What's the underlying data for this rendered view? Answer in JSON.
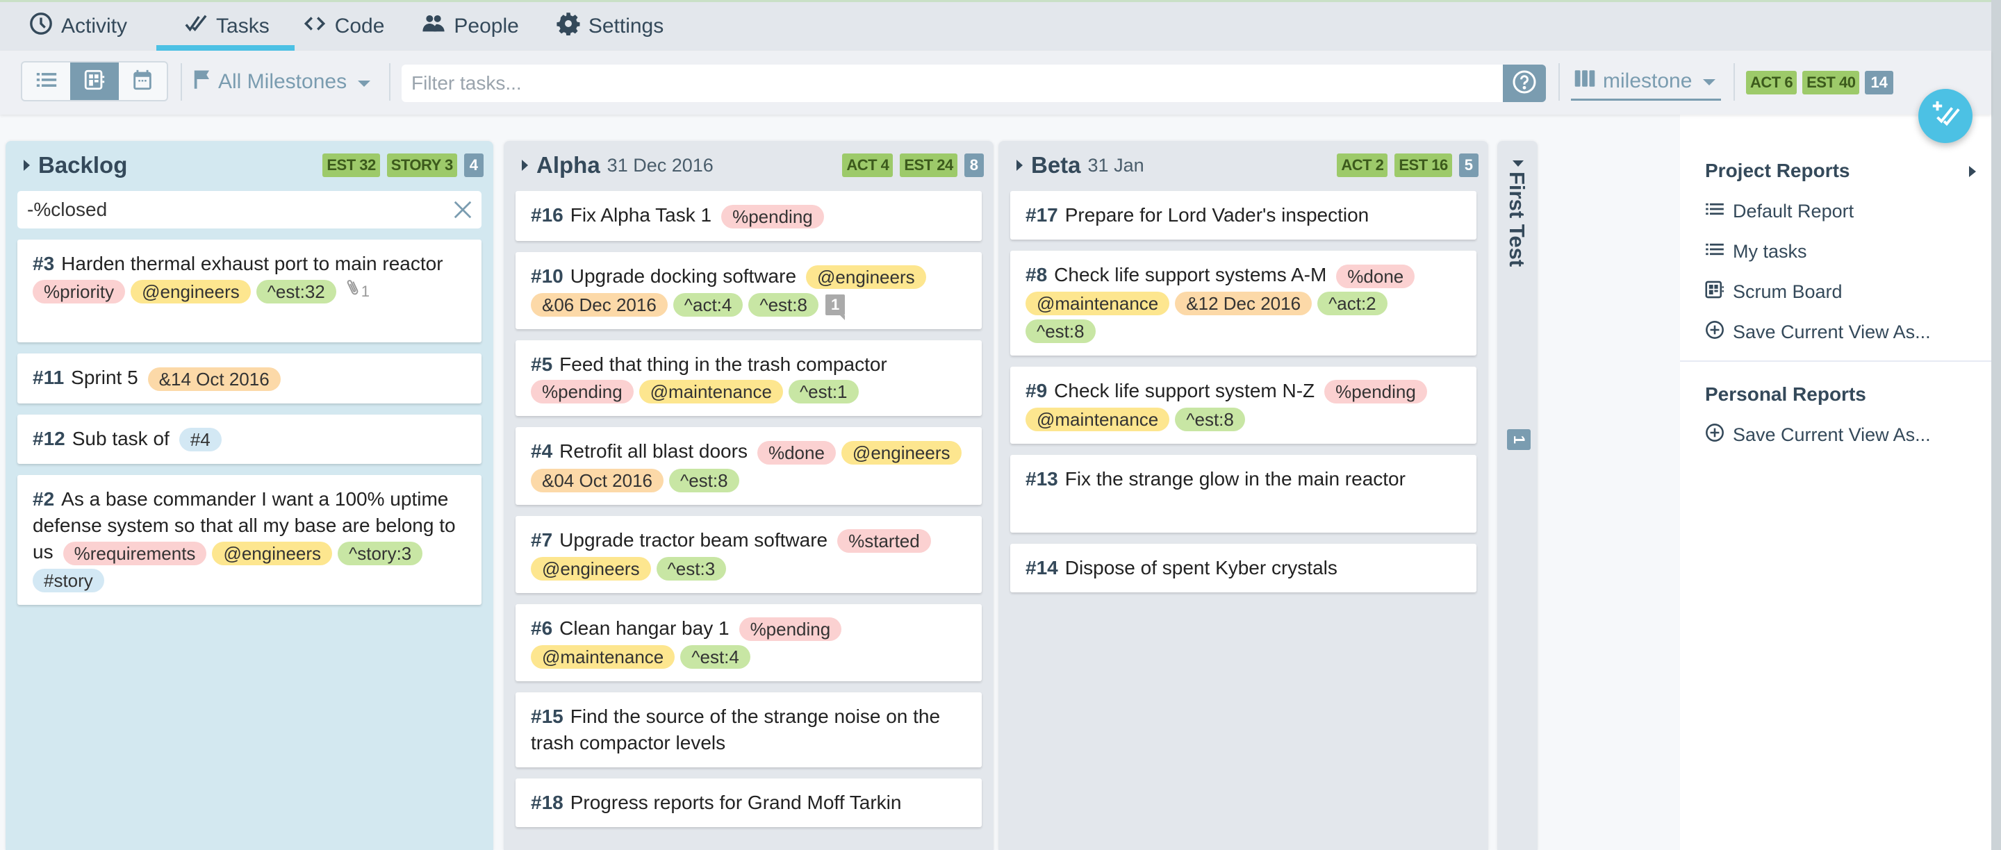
{
  "nav": {
    "tabs": [
      {
        "label": "Activity",
        "icon": "clock-icon"
      },
      {
        "label": "Tasks",
        "icon": "double-check-icon",
        "active": true
      },
      {
        "label": "Code",
        "icon": "code-icon"
      },
      {
        "label": "People",
        "icon": "people-icon"
      },
      {
        "label": "Settings",
        "icon": "gear-icon"
      }
    ]
  },
  "toolbar": {
    "view_modes": [
      "list",
      "board",
      "calendar"
    ],
    "active_view": "board",
    "milestone_filter": "All Milestones",
    "filter_placeholder": "Filter tasks...",
    "filter_value": "",
    "group_by": "milestone",
    "totals": {
      "act": "ACT 6",
      "est": "EST 40",
      "count": "14"
    }
  },
  "columns": {
    "backlog": {
      "title": "Backlog",
      "date": "",
      "badges": {
        "est": "EST 32",
        "story": "STORY 3",
        "count": "4"
      },
      "filter_value": "-%closed",
      "cards": [
        {
          "num": "#3",
          "title": "Harden thermal exhaust port to main reactor",
          "tags": [
            {
              "text": "%priority",
              "type": "status"
            },
            {
              "text": "@engineers",
              "type": "person"
            },
            {
              "text": "^est:32",
              "type": "est"
            }
          ],
          "attachments": "1"
        },
        {
          "num": "#11",
          "title": "Sprint 5",
          "tags": [
            {
              "text": "&14 Oct 2016",
              "type": "date"
            }
          ]
        },
        {
          "num": "#12",
          "title": "Sub task of",
          "tags": [
            {
              "text": "#4",
              "type": "ref"
            }
          ]
        },
        {
          "num": "#2",
          "title": "As a base commander I want a 100% uptime defense system so that all my base are belong to us",
          "tags": [
            {
              "text": "%requirements",
              "type": "status"
            },
            {
              "text": "@engineers",
              "type": "person"
            },
            {
              "text": "^story:3",
              "type": "est"
            },
            {
              "text": "#story",
              "type": "ref"
            }
          ]
        }
      ]
    },
    "alpha": {
      "title": "Alpha",
      "date": "31 Dec 2016",
      "badges": {
        "act": "ACT 4",
        "est": "EST 24",
        "count": "8"
      },
      "cards": [
        {
          "num": "#16",
          "title": "Fix Alpha Task 1",
          "tags": [
            {
              "text": "%pending",
              "type": "status"
            }
          ]
        },
        {
          "num": "#10",
          "title": "Upgrade docking software",
          "tags": [
            {
              "text": "@engineers",
              "type": "person"
            },
            {
              "text": "&06 Dec 2016",
              "type": "date"
            },
            {
              "text": "^act:4",
              "type": "est"
            },
            {
              "text": "^est:8",
              "type": "est"
            }
          ],
          "comments": "1"
        },
        {
          "num": "#5",
          "title": "Feed that thing in the trash compactor",
          "tags": [
            {
              "text": "%pending",
              "type": "status"
            },
            {
              "text": "@maintenance",
              "type": "person"
            },
            {
              "text": "^est:1",
              "type": "est"
            }
          ]
        },
        {
          "num": "#4",
          "title": "Retrofit all blast doors",
          "tags": [
            {
              "text": "%done",
              "type": "status"
            },
            {
              "text": "@engineers",
              "type": "person"
            },
            {
              "text": "&04 Oct 2016",
              "type": "date"
            },
            {
              "text": "^est:8",
              "type": "est"
            }
          ]
        },
        {
          "num": "#7",
          "title": "Upgrade tractor beam software",
          "tags": [
            {
              "text": "%started",
              "type": "status"
            },
            {
              "text": "@engineers",
              "type": "person"
            },
            {
              "text": "^est:3",
              "type": "est"
            }
          ]
        },
        {
          "num": "#6",
          "title": "Clean hangar bay 1",
          "tags": [
            {
              "text": "%pending",
              "type": "status"
            },
            {
              "text": "@maintenance",
              "type": "person"
            },
            {
              "text": "^est:4",
              "type": "est"
            }
          ]
        },
        {
          "num": "#15",
          "title": "Find the source of the strange noise on the trash compactor levels",
          "tags": []
        },
        {
          "num": "#18",
          "title": "Progress reports for Grand Moff Tarkin",
          "tags": []
        }
      ]
    },
    "beta": {
      "title": "Beta",
      "date": "31 Jan",
      "badges": {
        "act": "ACT 2",
        "est": "EST 16",
        "count": "5"
      },
      "cards": [
        {
          "num": "#17",
          "title": "Prepare for Lord Vader's inspection",
          "tags": []
        },
        {
          "num": "#8",
          "title": "Check life support systems A-M",
          "tags": [
            {
              "text": "%done",
              "type": "status"
            },
            {
              "text": "@maintenance",
              "type": "person"
            },
            {
              "text": "&12 Dec 2016",
              "type": "date"
            },
            {
              "text": "^act:2",
              "type": "est"
            },
            {
              "text": "^est:8",
              "type": "est"
            }
          ]
        },
        {
          "num": "#9",
          "title": "Check life support system N-Z",
          "tags": [
            {
              "text": "%pending",
              "type": "status"
            },
            {
              "text": "@maintenance",
              "type": "person"
            },
            {
              "text": "^est:8",
              "type": "est"
            }
          ]
        },
        {
          "num": "#13",
          "title": "Fix the strange glow in the main reactor",
          "tags": []
        },
        {
          "num": "#14",
          "title": "Dispose of spent Kyber crystals",
          "tags": []
        }
      ]
    },
    "first_test": {
      "title": "First Test",
      "count": "1",
      "collapsed": true
    }
  },
  "reports": {
    "project": {
      "heading": "Project Reports",
      "items": [
        {
          "label": "Default Report",
          "icon": "list-icon"
        },
        {
          "label": "My tasks",
          "icon": "list-icon"
        },
        {
          "label": "Scrum Board",
          "icon": "board-icon"
        },
        {
          "label": "Save Current View As...",
          "icon": "plus-circle-icon"
        }
      ]
    },
    "personal": {
      "heading": "Personal Reports",
      "items": [
        {
          "label": "Save Current View As...",
          "icon": "plus-circle-icon"
        }
      ]
    }
  },
  "colors": {
    "accent": "#4cc1e4",
    "slate": "#7a9cb0",
    "badge_green": "#9dca6a",
    "backlog_bg": "#d3e8f0",
    "column_bg": "#e3e7ec",
    "tag_status": "#fbd1d1",
    "tag_person": "#fde68f",
    "tag_date": "#fcd9a8",
    "tag_est": "#c8e6a4",
    "tag_ref": "#d3e8f4"
  }
}
